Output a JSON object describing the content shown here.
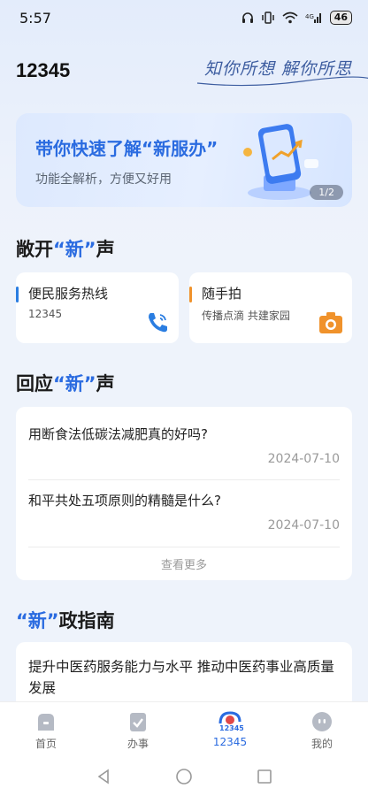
{
  "status": {
    "time": "5:57",
    "battery": "46"
  },
  "header": {
    "title": "12345",
    "slogan": "知你所想 解你所思"
  },
  "banner": {
    "title": "带你快速了解“新服办”",
    "subtitle": "功能全解析，方便又好用",
    "pager": "1/2"
  },
  "section1": {
    "pre": "敞开",
    "quote": "“新”",
    "post": "声"
  },
  "cards": [
    {
      "title": "便民服务热线",
      "subtitle": "12345",
      "accent": "#2a7de1",
      "icon": "phone-icon"
    },
    {
      "title": "随手拍",
      "subtitle": "传播点滴 共建家园",
      "accent": "#f0922b",
      "icon": "camera-icon"
    }
  ],
  "section2": {
    "pre": "回应",
    "quote": "“新”",
    "post": "声"
  },
  "qa": {
    "items": [
      {
        "question": "用断食法低碳法减肥真的好吗?",
        "date": "2024-07-10"
      },
      {
        "question": "和平共处五项原则的精髓是什么?",
        "date": "2024-07-10"
      }
    ],
    "more": "查看更多"
  },
  "section3": {
    "pre": "",
    "quote": "“新”",
    "post": "政指南"
  },
  "policy": {
    "text": "提升中医药服务能力与水平 推动中医药事业高质量发展"
  },
  "tabs": [
    {
      "label": "首页",
      "icon": "home-icon"
    },
    {
      "label": "办事",
      "icon": "task-icon"
    },
    {
      "label": "12345",
      "icon": "hotline-logo-icon",
      "active": true
    },
    {
      "label": "我的",
      "icon": "profile-icon"
    }
  ],
  "colors": {
    "accent": "#2a6be0",
    "background": "#eef3fb"
  }
}
